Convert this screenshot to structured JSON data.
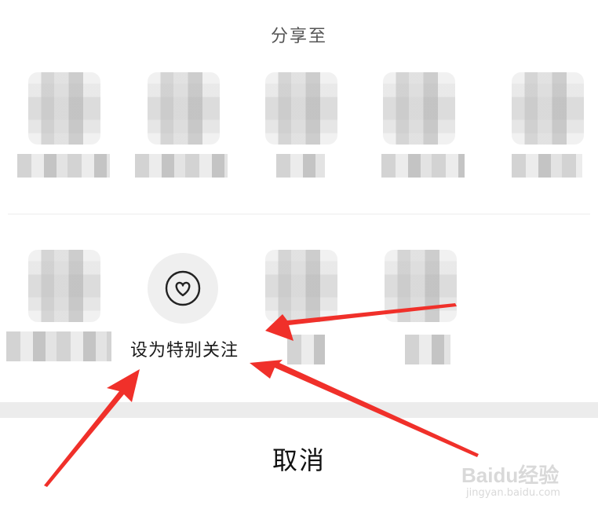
{
  "sheet": {
    "title": "分享至",
    "special_follow_label": "设为特别关注",
    "special_follow_icon": "heart-icon",
    "cancel_label": "取消"
  },
  "watermark": {
    "main": "Baidu经验",
    "sub": "jingyan.baidu.com"
  },
  "colors": {
    "arrow": "#f0302a",
    "background": "#ffffff",
    "band": "#ececec",
    "circle": "#efefef"
  }
}
